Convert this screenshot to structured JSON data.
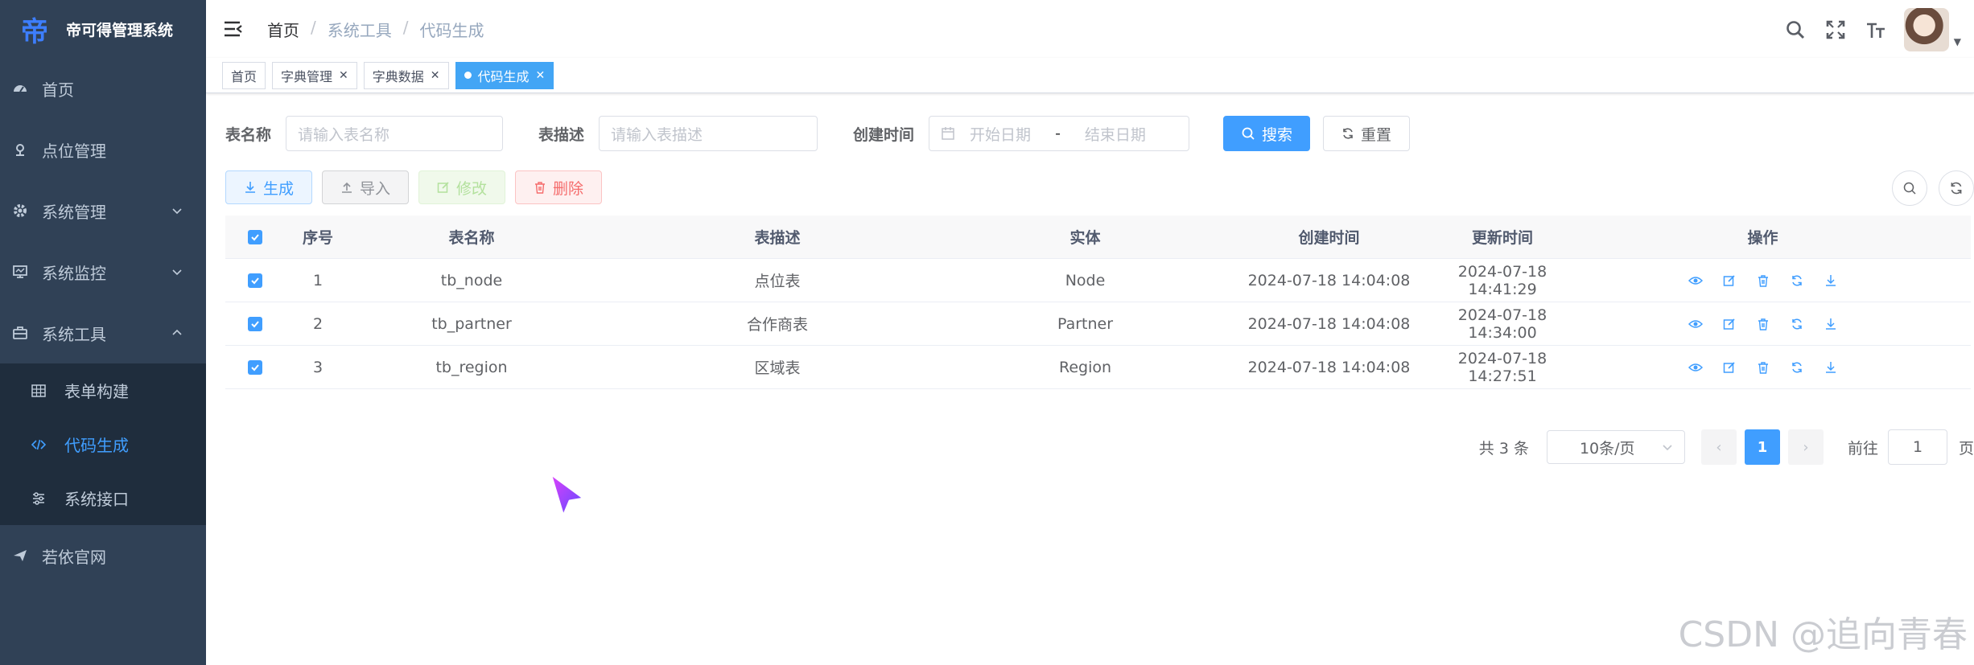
{
  "app": {
    "logo_char": "帝",
    "title": "帝可得管理系统"
  },
  "sidebar": {
    "items": [
      {
        "label": "首页",
        "icon": "dashboard-icon"
      },
      {
        "label": "点位管理",
        "icon": "location-icon"
      },
      {
        "label": "系统管理",
        "icon": "gear-icon"
      },
      {
        "label": "系统监控",
        "icon": "monitor-icon"
      },
      {
        "label": "系统工具",
        "icon": "toolbox-icon"
      }
    ],
    "sub_items": [
      {
        "label": "表单构建",
        "icon": "table-icon"
      },
      {
        "label": "代码生成",
        "icon": "code-icon"
      },
      {
        "label": "系统接口",
        "icon": "sliders-icon"
      }
    ],
    "footer_item": {
      "label": "若依官网",
      "icon": "send-icon"
    }
  },
  "breadcrumb": {
    "home": "首页",
    "sep": "/",
    "level1": "系统工具",
    "level2": "代码生成"
  },
  "tags": [
    {
      "label": "首页"
    },
    {
      "label": "字典管理"
    },
    {
      "label": "字典数据"
    },
    {
      "label": "代码生成"
    }
  ],
  "search_form": {
    "table_name_label": "表名称",
    "table_name_placeholder": "请输入表名称",
    "table_desc_label": "表描述",
    "table_desc_placeholder": "请输入表描述",
    "created_label": "创建时间",
    "start_placeholder": "开始日期",
    "range_sep": "-",
    "end_placeholder": "结束日期",
    "search_button": "搜索",
    "reset_button": "重置"
  },
  "toolbar": {
    "generate": "生成",
    "import": "导入",
    "modify": "修改",
    "delete": "删除"
  },
  "table": {
    "headers": [
      "序号",
      "表名称",
      "表描述",
      "实体",
      "创建时间",
      "更新时间",
      "操作"
    ],
    "rows": [
      {
        "idx": "1",
        "name": "tb_node",
        "desc": "点位表",
        "entity": "Node",
        "created": "2024-07-18 14:04:08",
        "updated": "2024-07-18 14:41:29"
      },
      {
        "idx": "2",
        "name": "tb_partner",
        "desc": "合作商表",
        "entity": "Partner",
        "created": "2024-07-18 14:04:08",
        "updated": "2024-07-18 14:34:00"
      },
      {
        "idx": "3",
        "name": "tb_region",
        "desc": "区域表",
        "entity": "Region",
        "created": "2024-07-18 14:04:08",
        "updated": "2024-07-18 14:27:51"
      }
    ]
  },
  "pagination": {
    "total": "共 3 条",
    "page_size": "10条/页",
    "current": "1",
    "goto_label": "前往",
    "goto_value": "1",
    "page_suffix": "页"
  },
  "watermark": "CSDN @追向青春",
  "colors": {
    "primary": "#409eff",
    "sidebar_bg": "#304156",
    "submenu_bg": "#1f2d3d"
  }
}
